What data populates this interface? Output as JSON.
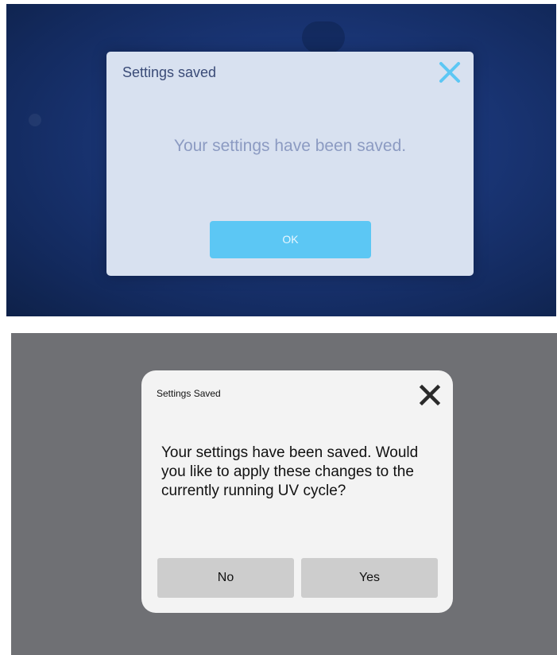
{
  "screens": [
    {
      "dialog": {
        "title": "Settings saved",
        "message": "Your settings have been saved.",
        "ok_label": "OK"
      },
      "colors": {
        "background": "#193473",
        "dialog_bg": "#d8e1f0",
        "title": "#3a4b77",
        "message": "#8c9bc2",
        "accent": "#5cc7f4"
      },
      "icons": {
        "close": "close-icon"
      }
    },
    {
      "dialog": {
        "title": "Settings Saved",
        "message": "Your settings have been saved. Would you like to apply these changes to the currently running UV cycle?",
        "no_label": "No",
        "yes_label": "Yes"
      },
      "colors": {
        "background": "#6f7074",
        "dialog_bg": "#f3f3f3",
        "button_bg": "#cdcdcd",
        "text": "#111111"
      },
      "icons": {
        "close": "close-icon"
      }
    }
  ]
}
